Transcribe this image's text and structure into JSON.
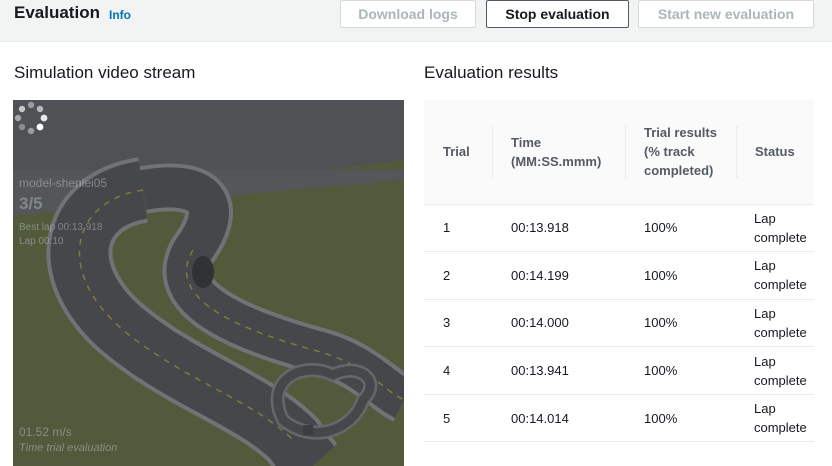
{
  "header": {
    "title": "Evaluation",
    "info_label": "Info",
    "buttons": {
      "download_logs": "Download logs",
      "stop_evaluation": "Stop evaluation",
      "start_new_evaluation": "Start new evaluation"
    }
  },
  "video": {
    "title": "Simulation video stream",
    "hud": {
      "model": "model-shenlei05",
      "trial": "3/5",
      "best_lap": "Best lap 00:13.918",
      "lap": "Lap 00:10",
      "speed": "01.52 m/s",
      "mode": "Time trial evaluation"
    },
    "colors": {
      "grass": "#5d6a3a",
      "track": "#4a4c50",
      "edge": "#8c8f93",
      "center_line": "#a89a3a"
    }
  },
  "results": {
    "title": "Evaluation results",
    "columns": {
      "trial": "Trial",
      "time": "Time (MM:SS.mmm)",
      "trial_results": "Trial results (% track completed)",
      "status": "Status"
    },
    "rows": [
      {
        "trial": "1",
        "time": "00:13.918",
        "completed": "100%",
        "status": "Lap complete"
      },
      {
        "trial": "2",
        "time": "00:14.199",
        "completed": "100%",
        "status": "Lap complete"
      },
      {
        "trial": "3",
        "time": "00:14.000",
        "completed": "100%",
        "status": "Lap complete"
      },
      {
        "trial": "4",
        "time": "00:13.941",
        "completed": "100%",
        "status": "Lap complete"
      },
      {
        "trial": "5",
        "time": "00:14.014",
        "completed": "100%",
        "status": "Lap complete"
      }
    ]
  }
}
